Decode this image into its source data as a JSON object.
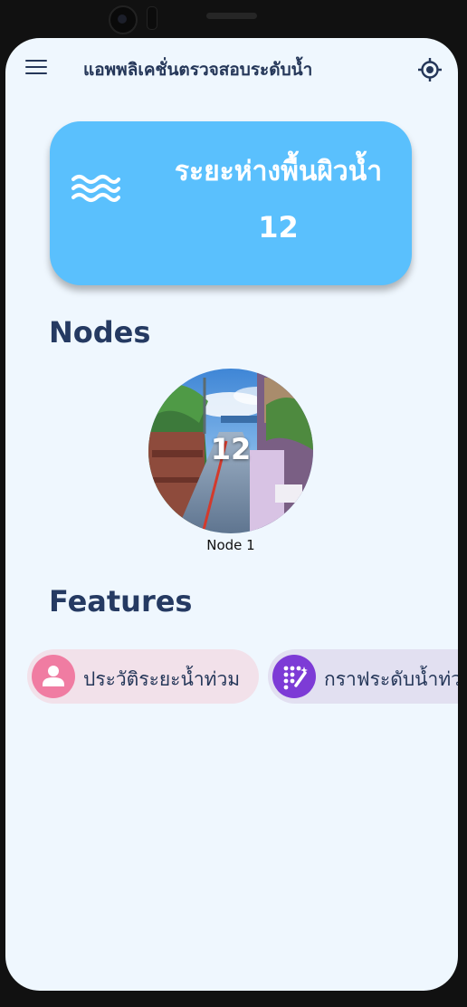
{
  "app": {
    "title": "แอพพลิเคชั่นตรวจสอบระดับน้ำ"
  },
  "water_card": {
    "title": "ระยะห่างพื้นผิวน้ำ",
    "value": "12",
    "icon": "waves-icon"
  },
  "nodes_section": {
    "title": "Nodes",
    "items": [
      {
        "label": "Node 1",
        "value": "12"
      }
    ]
  },
  "features_section": {
    "title": "Features",
    "items": [
      {
        "label": "ประวัติระยะน้ำท่วม",
        "icon": "person-icon",
        "color": "#f07ca2",
        "bg": "#f2e1ea"
      },
      {
        "label": "กราฟระดับน้ำท่วม",
        "icon": "magic-wand-icon",
        "color": "#7d3bd6",
        "bg": "#e2e0f1"
      }
    ]
  },
  "colors": {
    "screen_bg": "#eff7fe",
    "card_bg": "#5ac0fd",
    "heading": "#253a62"
  }
}
